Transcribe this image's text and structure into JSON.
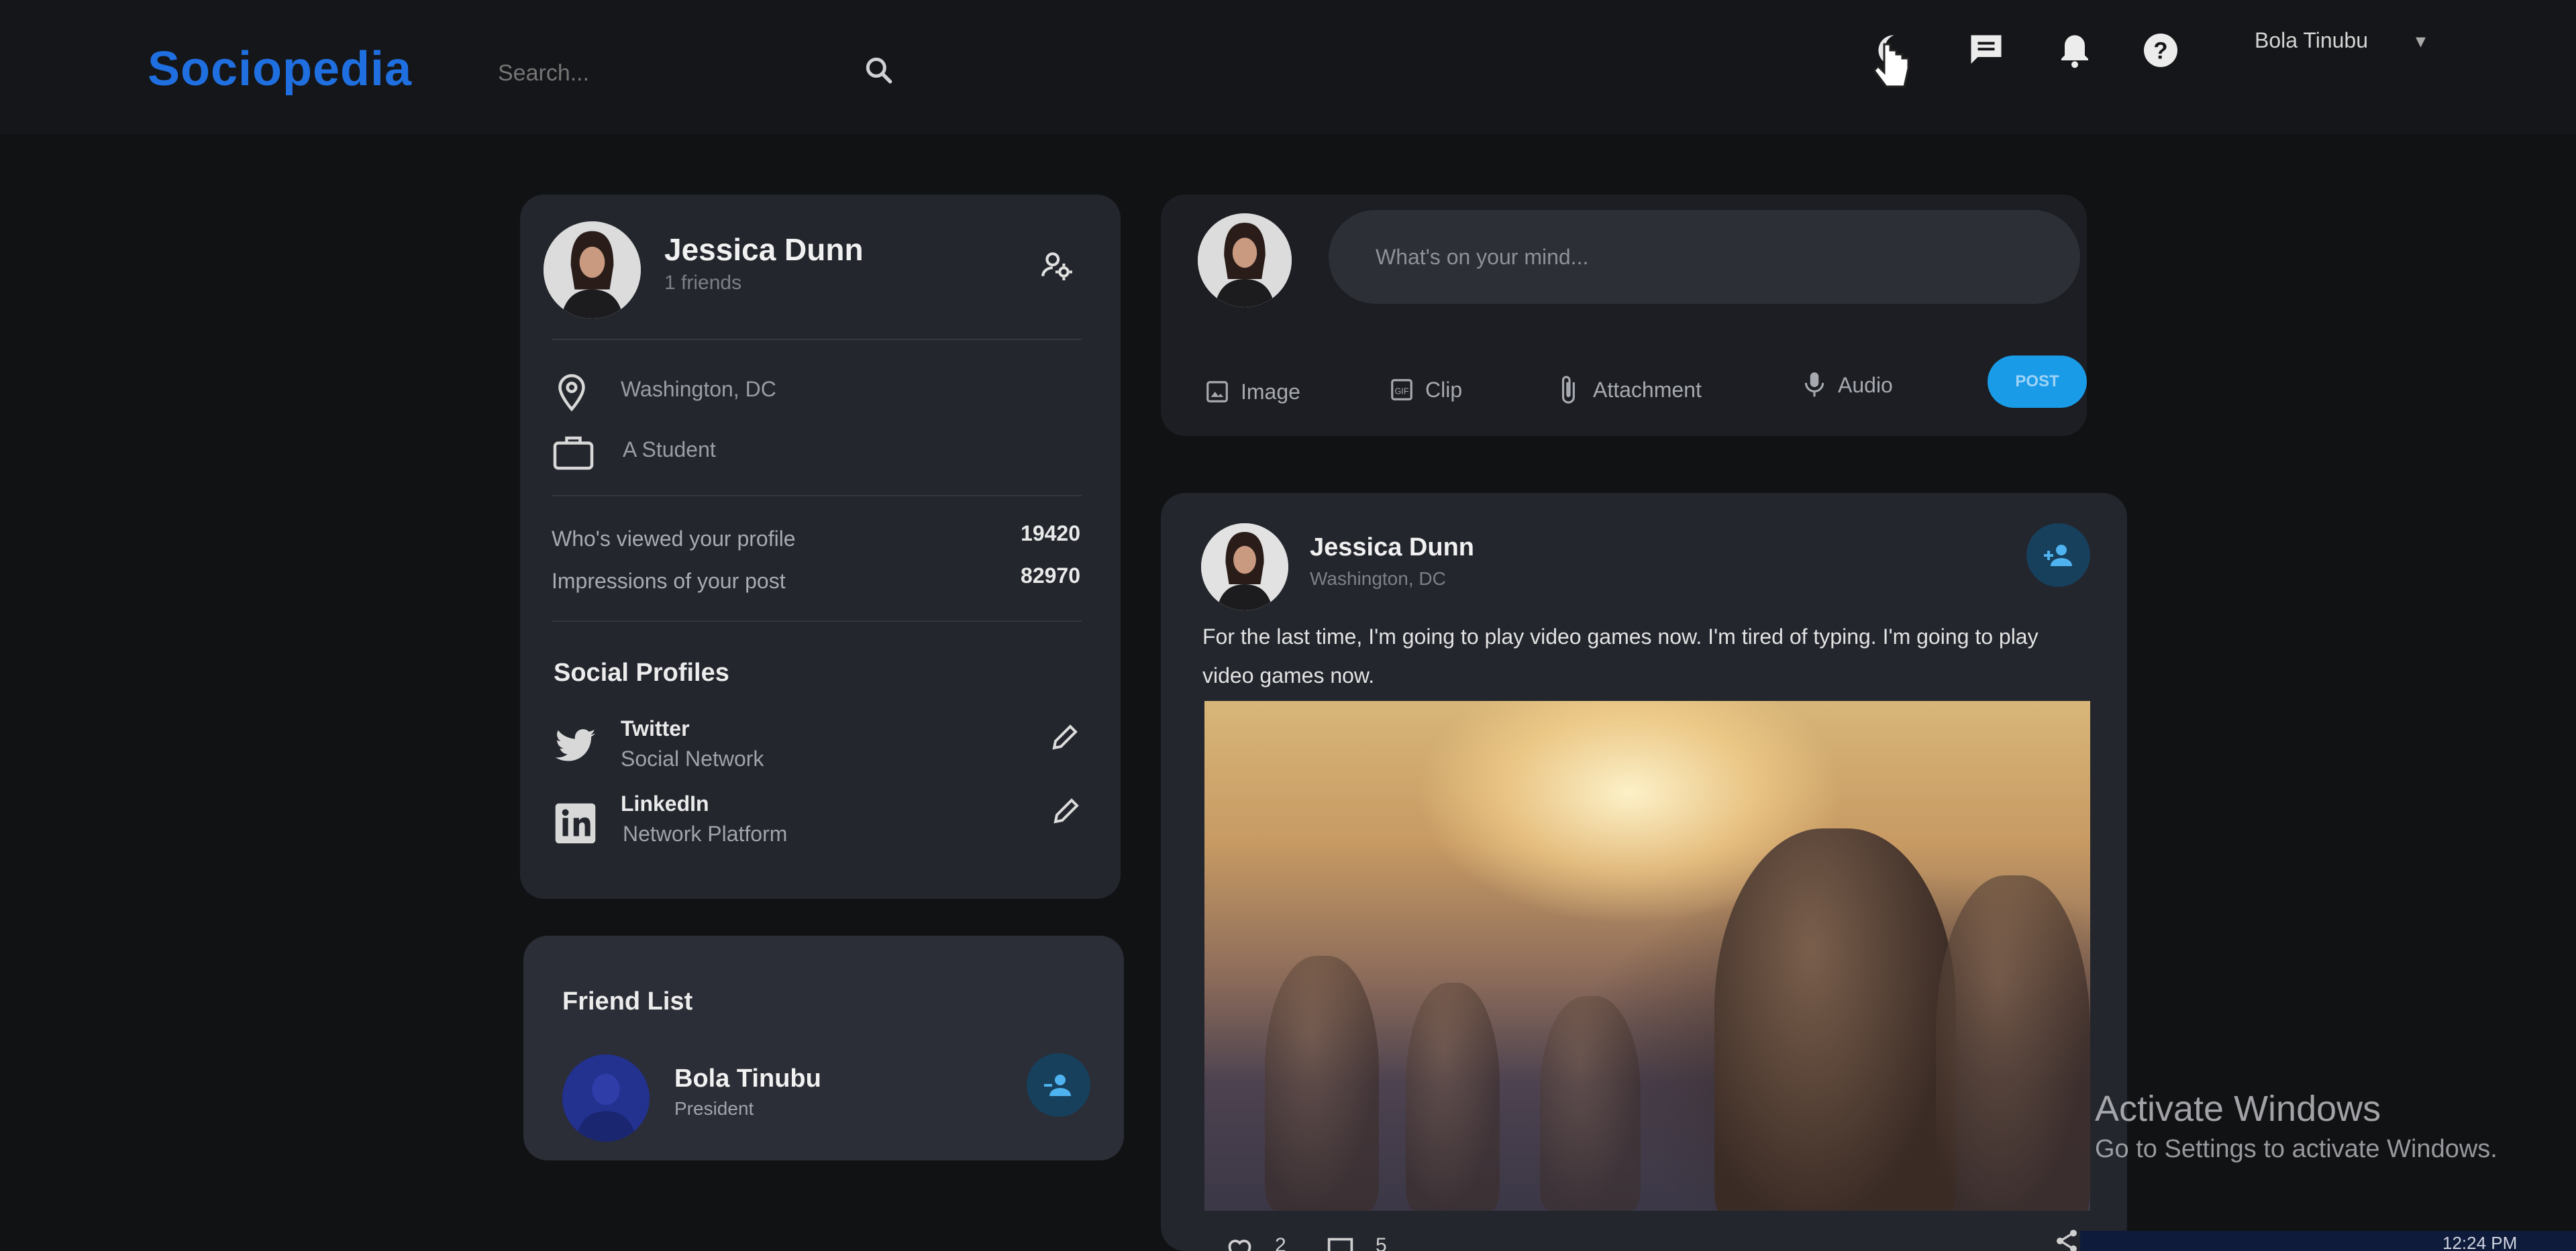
{
  "header": {
    "logo": "Sociopedia",
    "search_placeholder": "Search...",
    "icons": [
      "dark-mode-icon",
      "message-icon",
      "notification-icon",
      "help-icon"
    ],
    "user_name": "Bola Tinubu",
    "user_caret": "▾"
  },
  "profile": {
    "name": "Jessica Dunn",
    "friends": "1 friends",
    "location": "Washington, DC",
    "occupation": "A Student",
    "stats": [
      {
        "label": "Who's viewed your profile",
        "value": "19420"
      },
      {
        "label": "Impressions of your post",
        "value": "82970"
      }
    ],
    "social_title": "Social Profiles",
    "social": [
      {
        "name": "Twitter",
        "sub": "Social Network"
      },
      {
        "name": "LinkedIn",
        "sub": "Network Platform"
      }
    ]
  },
  "friend_list": {
    "title": "Friend List",
    "friends": [
      {
        "name": "Bola Tinubu",
        "sub": "President"
      }
    ]
  },
  "composer": {
    "placeholder": "What's on your mind...",
    "actions": [
      "Image",
      "Clip",
      "Attachment",
      "Audio"
    ],
    "post_label": "POST"
  },
  "post": {
    "author": "Jessica Dunn",
    "location": "Washington, DC",
    "text": "For the last time, I'm going to play video games now. I'm tired of typing. I'm going to play video games now.",
    "likes": "2",
    "comments": "5"
  },
  "os": {
    "activate_title": "Activate Windows",
    "activate_sub": "Go to Settings to activate Windows.",
    "clock": "12:24 PM"
  },
  "colors": {
    "brand": "#1f6fe0",
    "background": "#111214",
    "widget": "#23262d",
    "accent": "#1a9be8"
  }
}
